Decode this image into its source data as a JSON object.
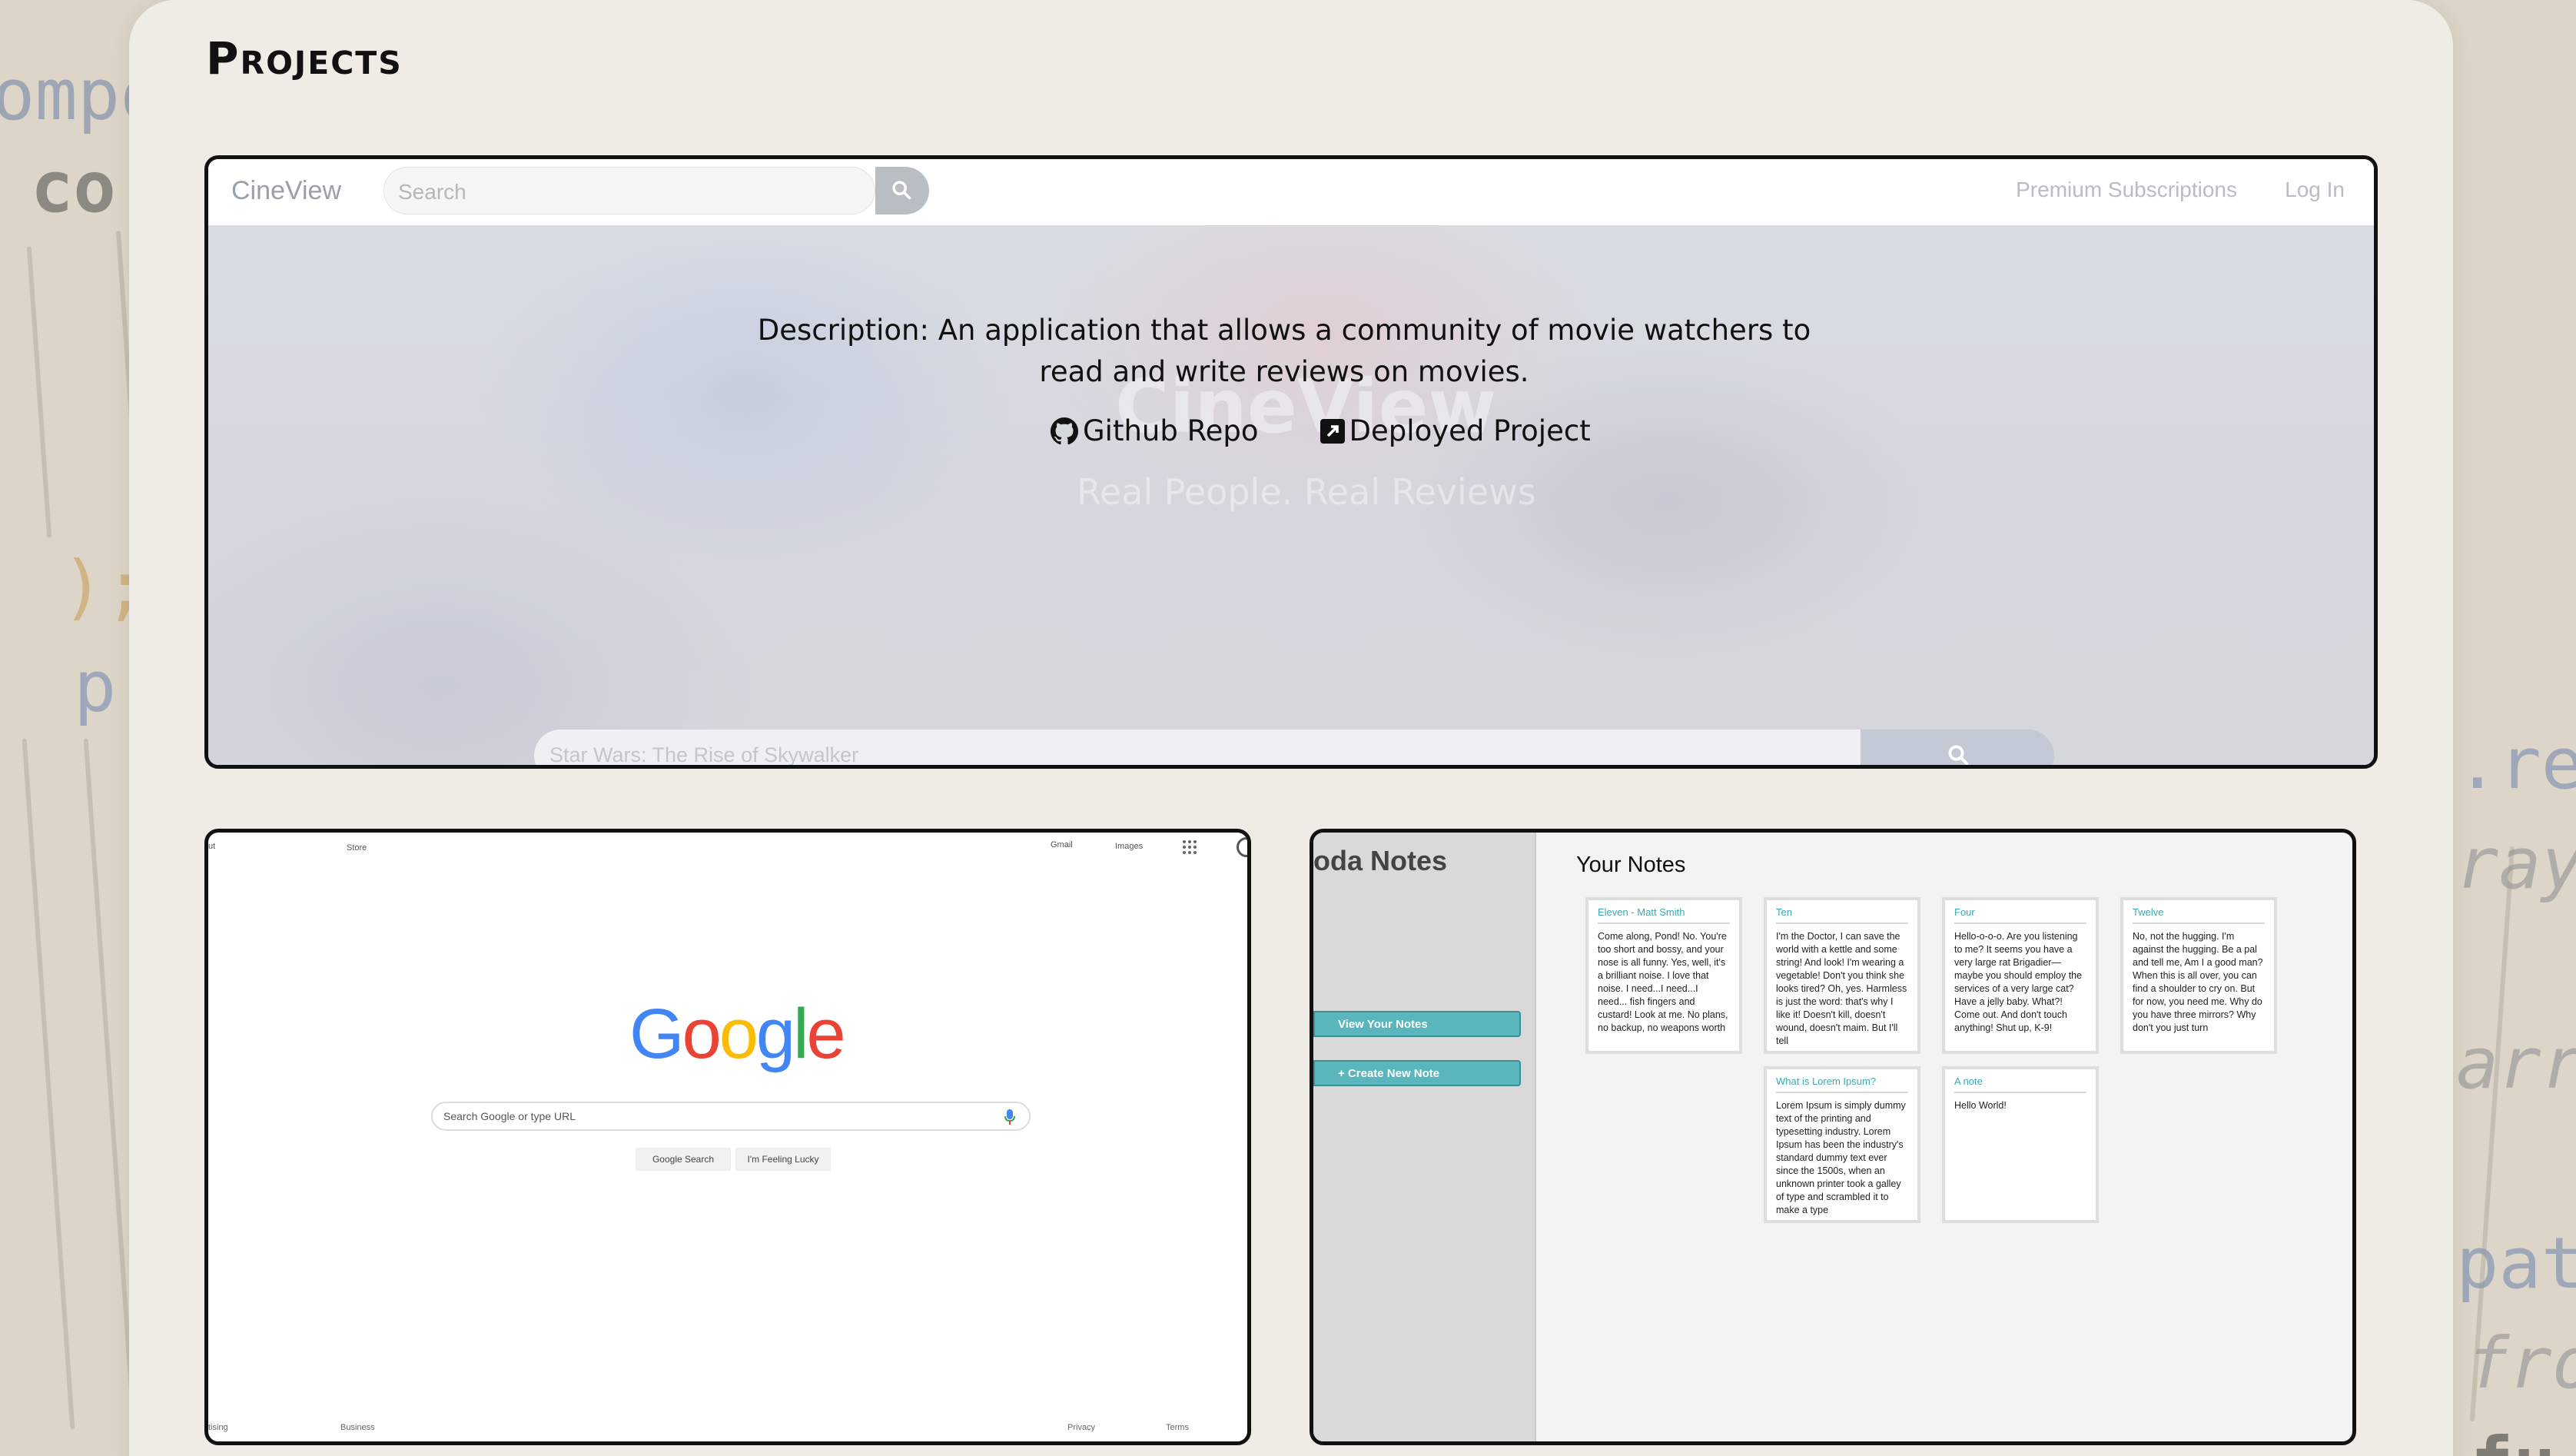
{
  "page": {
    "heading": "Projects"
  },
  "background": {
    "tokens": [
      "ompo",
      "co",
      ");",
      "p",
      ".re",
      "ray",
      "arra",
      "pat",
      "fro",
      "fu"
    ]
  },
  "cineview": {
    "brand": "CineView",
    "search_placeholder": "Search",
    "nav": [
      "Premium Subscriptions",
      "Log In"
    ],
    "hero_title": "CineView",
    "hero_subtitle": "Real People. Real Reviews",
    "description": "Description: An application that allows a community of movie watchers to read and write reviews on movies.",
    "links": {
      "github": "Github Repo",
      "deployed": "Deployed Project"
    },
    "hero_search_placeholder": "Star Wars: The Rise of Skywalker"
  },
  "google": {
    "top_left": [
      "ut",
      "Store"
    ],
    "top_right": [
      "Gmail",
      "Images"
    ],
    "logo": [
      "G",
      "o",
      "o",
      "g",
      "l",
      "e"
    ],
    "logo_colors": [
      "#4285F4",
      "#EA4335",
      "#FBBC05",
      "#4285F4",
      "#34A853",
      "#EA4335"
    ],
    "search_placeholder": "Search Google or type URL",
    "buttons": [
      "Google Search",
      "I'm Feeling Lucky"
    ],
    "footer_left": [
      "tising",
      "Business"
    ],
    "footer_right": [
      "Privacy",
      "Terms"
    ]
  },
  "notes": {
    "app_title": "oda Notes",
    "sidebar_buttons": [
      "View Your Notes",
      "+ Create New Note"
    ],
    "heading": "Your Notes",
    "items": [
      {
        "title": "Eleven - Matt Smith",
        "body": "Come along, Pond! No. You're too short and bossy, and your nose is all funny. Yes, well, it's a brilliant noise. I love that noise. I need...I need...I need... fish fingers and custard! Look at me. No plans, no backup, no weapons worth"
      },
      {
        "title": "Ten",
        "body": "I'm the Doctor, I can save the world with a kettle and some string! And look! I'm wearing a vegetable! Don't you think she looks tired? Oh, yes. Harmless is just the word: that's why I like it! Doesn't kill, doesn't wound, doesn't maim. But I'll tell"
      },
      {
        "title": "Four",
        "body": "Hello-o-o-o. Are you listening to me? It seems you have a very large rat Brigadier—maybe you should employ the services of a very large cat? Have a jelly baby. What?! Come out. And don't touch anything! Shut up, K-9!"
      },
      {
        "title": "Twelve",
        "body": "No, not the hugging. I'm against the hugging. Be a pal and tell me, Am I a good man? When this is all over, you can find a shoulder to cry on. But for now, you need me. Why do you have three mirrors? Why don't you just turn"
      },
      {
        "title": "What is Lorem Ipsum?",
        "body": "Lorem Ipsum is simply dummy text of the printing and typesetting industry. Lorem Ipsum has been the industry's standard dummy text ever since the 1500s, when an unknown printer took a galley of type and scrambled it to make a type"
      },
      {
        "title": "A note",
        "body": "Hello World!"
      }
    ]
  }
}
